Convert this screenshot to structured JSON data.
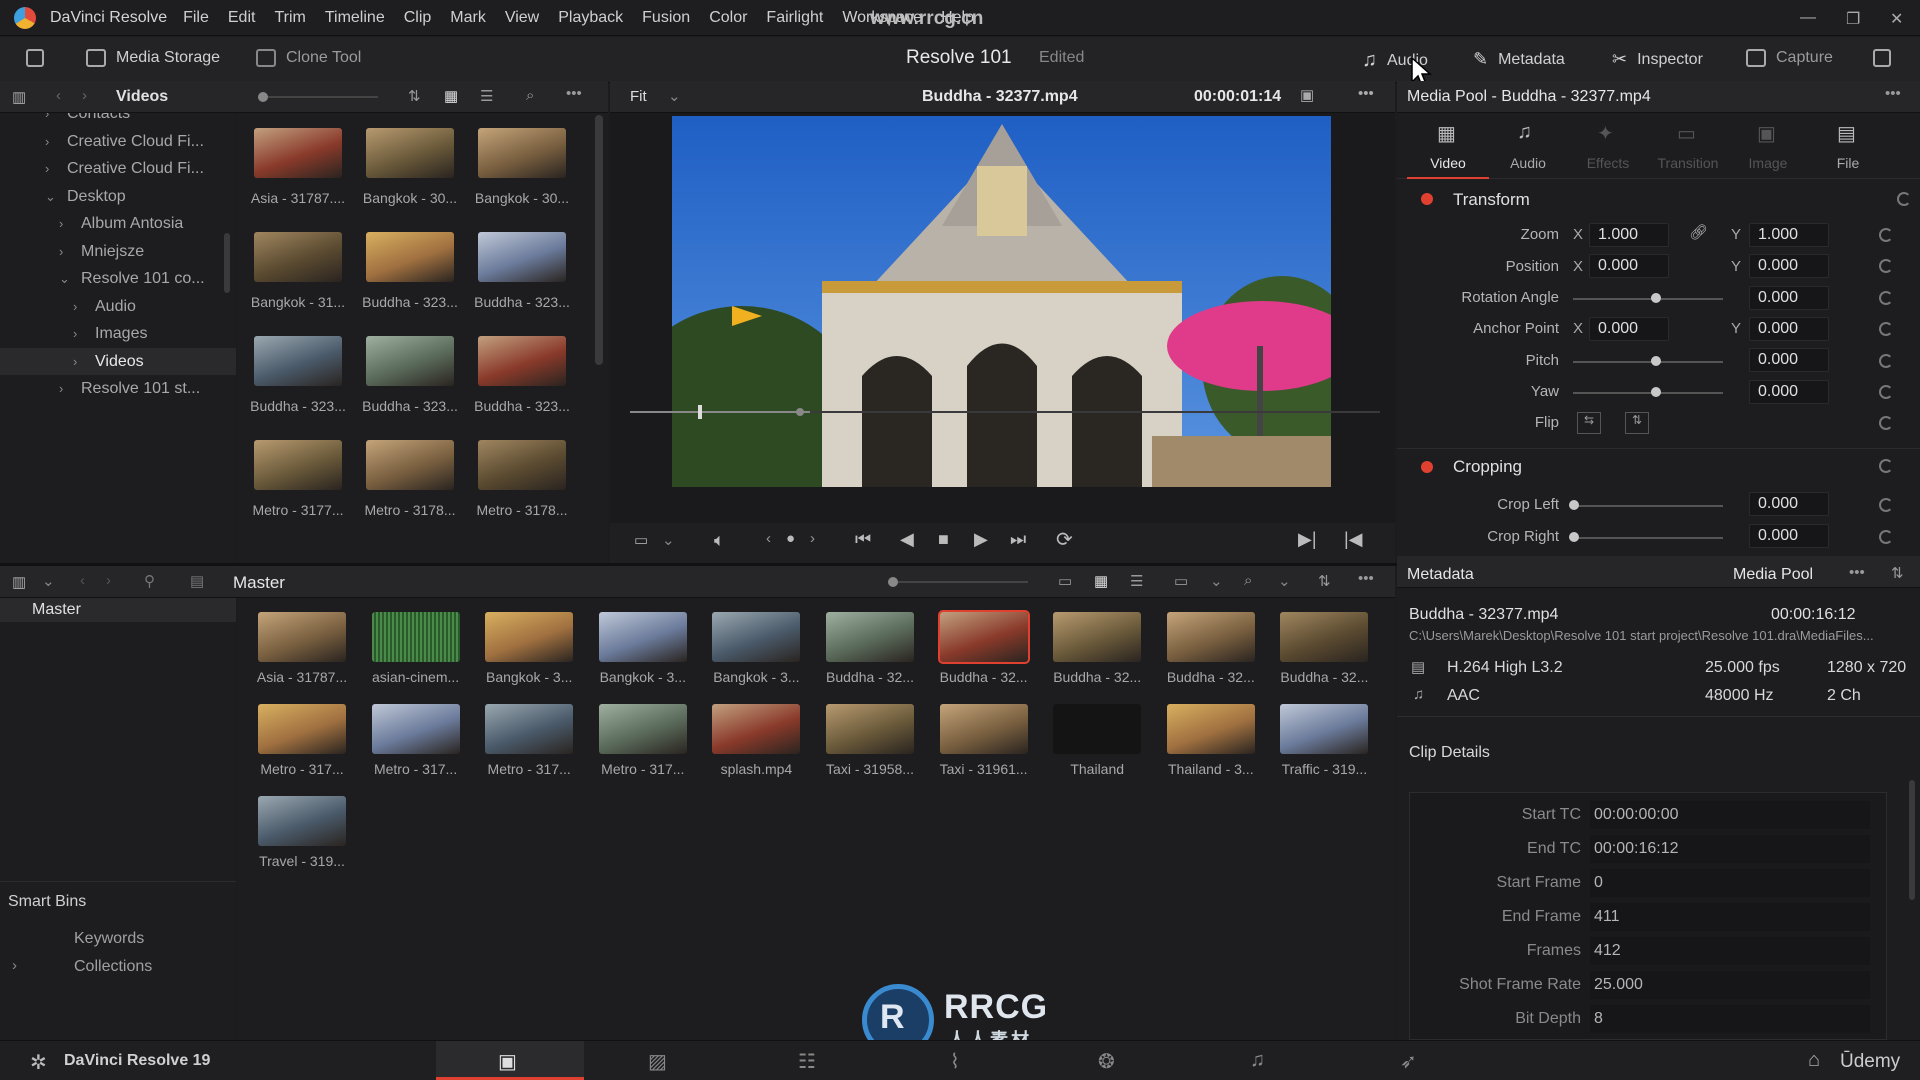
{
  "app": {
    "name": "DaVinci Resolve",
    "watermark_url": "www.rrcg.cn",
    "footer_name": "DaVinci Resolve 19",
    "udemy": "Ūdemy"
  },
  "menu": [
    "File",
    "Edit",
    "Trim",
    "Timeline",
    "Clip",
    "Mark",
    "View",
    "Playback",
    "Fusion",
    "Color",
    "Fairlight",
    "Workspace",
    "Help"
  ],
  "toolbar": {
    "media_storage": "Media Storage",
    "clone_tool": "Clone Tool",
    "project_title": "Resolve 101",
    "project_status": "Edited",
    "audio": "Audio",
    "metadata": "Metadata",
    "inspector": "Inspector",
    "capture": "Capture"
  },
  "media_storage": {
    "header": "Videos",
    "tree": [
      {
        "label": "Contacts",
        "indent": 1,
        "arrow": "›"
      },
      {
        "label": "Creative Cloud Fi...",
        "indent": 1,
        "arrow": "›"
      },
      {
        "label": "Creative Cloud Fi...",
        "indent": 1,
        "arrow": "›"
      },
      {
        "label": "Desktop",
        "indent": 1,
        "arrow": "⌄"
      },
      {
        "label": "Album Antosia",
        "indent": 2,
        "arrow": "›"
      },
      {
        "label": "Mniejsze",
        "indent": 2,
        "arrow": "›"
      },
      {
        "label": "Resolve 101 co...",
        "indent": 2,
        "arrow": "⌄"
      },
      {
        "label": "Audio",
        "indent": 3,
        "arrow": "›"
      },
      {
        "label": "Images",
        "indent": 3,
        "arrow": "›"
      },
      {
        "label": "Videos",
        "indent": 3,
        "arrow": "›",
        "selected": true
      },
      {
        "label": "Resolve 101 st...",
        "indent": 2,
        "arrow": "›"
      }
    ],
    "clips": [
      "Asia - 31787....",
      "Bangkok - 30...",
      "Bangkok - 30...",
      "Bangkok - 31...",
      "Buddha - 323...",
      "Buddha - 323...",
      "Buddha - 323...",
      "Buddha - 323...",
      "Buddha - 323...",
      "Metro - 3177...",
      "Metro - 3178...",
      "Metro - 3178..."
    ]
  },
  "viewer": {
    "zoom": "Fit",
    "clip_name": "Buddha - 32377.mp4",
    "timecode": "00:00:01:14"
  },
  "inspector": {
    "title": "Media Pool - Buddha - 32377.mp4",
    "tabs": [
      "Video",
      "Audio",
      "Effects",
      "Transition",
      "Image",
      "File"
    ],
    "transform": "Transform",
    "zoom_label": "Zoom",
    "zoom_x": "1.000",
    "zoom_y": "1.000",
    "position_label": "Position",
    "position_x": "0.000",
    "position_y": "0.000",
    "rotation_label": "Rotation Angle",
    "rotation": "0.000",
    "anchor_label": "Anchor Point",
    "anchor_x": "0.000",
    "anchor_y": "0.000",
    "pitch_label": "Pitch",
    "pitch": "0.000",
    "yaw_label": "Yaw",
    "yaw": "0.000",
    "flip_label": "Flip",
    "x": "X",
    "y": "Y",
    "cropping": "Cropping",
    "crop_left_label": "Crop Left",
    "crop_left": "0.000",
    "crop_right_label": "Crop Right",
    "crop_right": "0.000"
  },
  "media_pool": {
    "header": "Master",
    "bin": "Master",
    "smart_bins": "Smart Bins",
    "keywords": "Keywords",
    "collections": "Collections",
    "clips": [
      "Asia - 31787...",
      "asian-cinem...",
      "Bangkok - 3...",
      "Bangkok - 3...",
      "Bangkok - 3...",
      "Buddha - 32...",
      "Buddha - 32...",
      "Buddha - 32...",
      "Buddha - 32...",
      "Buddha - 32...",
      "Metro - 317...",
      "Metro - 317...",
      "Metro - 317...",
      "Metro - 317...",
      "splash.mp4",
      "Taxi - 31958...",
      "Taxi - 31961...",
      "Thailand",
      "Thailand - 3...",
      "Traffic - 319...",
      "Travel - 319..."
    ]
  },
  "metadata": {
    "header": "Metadata",
    "source": "Media Pool",
    "clip_name": "Buddha - 32377.mp4",
    "duration": "00:00:16:12",
    "path": "C:\\Users\\Marek\\Desktop\\Resolve 101 start project\\Resolve 101.dra\\MediaFiles...",
    "video_codec": "H.264 High L3.2",
    "fps": "25.000 fps",
    "resolution": "1280 x 720",
    "audio_codec": "AAC",
    "sample_rate": "48000 Hz",
    "channels": "2 Ch",
    "clip_details": "Clip Details",
    "details": [
      {
        "k": "Start TC",
        "v": "00:00:00:00"
      },
      {
        "k": "End TC",
        "v": "00:00:16:12"
      },
      {
        "k": "Start Frame",
        "v": "0"
      },
      {
        "k": "End Frame",
        "v": "411"
      },
      {
        "k": "Frames",
        "v": "412"
      },
      {
        "k": "Shot Frame Rate",
        "v": "25.000"
      },
      {
        "k": "Bit Depth",
        "v": "8"
      }
    ]
  },
  "logo_text": {
    "rrcg": "RRCG",
    "sub": "人人素材"
  }
}
